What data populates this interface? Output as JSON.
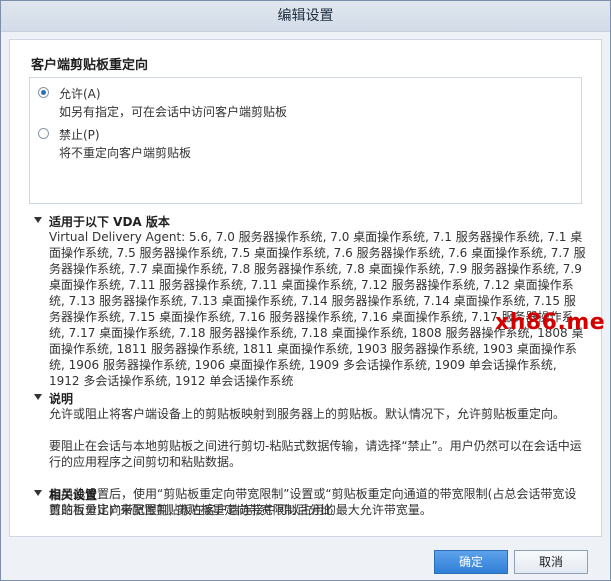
{
  "window": {
    "title": "编辑设置"
  },
  "section": {
    "title": "客户端剪贴板重定向"
  },
  "options": [
    {
      "label": "允许(A)",
      "desc": "如另有指定，可在会话中访问客户端剪贴板",
      "selected": true
    },
    {
      "label": "禁止(P)",
      "desc": "将不重定向客户端剪贴板",
      "selected": false
    }
  ],
  "applies_to": {
    "title": "适用于以下 VDA 版本",
    "text": "Virtual Delivery Agent: 5.6, 7.0 服务器操作系统, 7.0 桌面操作系统, 7.1 服务器操作系统, 7.1 桌面操作系统, 7.5 服务器操作系统, 7.5 桌面操作系统, 7.6 服务器操作系统, 7.6 桌面操作系统, 7.7 服务器操作系统, 7.7 桌面操作系统, 7.8 服务器操作系统, 7.8 桌面操作系统, 7.9 服务器操作系统, 7.9 桌面操作系统, 7.11 服务器操作系统, 7.11 桌面操作系统, 7.12 服务器操作系统, 7.12 桌面操作系统, 7.13 服务器操作系统, 7.13 桌面操作系统, 7.14 服务器操作系统, 7.14 桌面操作系统, 7.15 服务器操作系统, 7.15 桌面操作系统, 7.16 服务器操作系统, 7.16 桌面操作系统, 7.17 服务器操作系统, 7.17 桌面操作系统, 7.18 服务器操作系统, 7.18 桌面操作系统, 1808 服务器操作系统, 1808 桌面操作系统, 1811 服务器操作系统, 1811 桌面操作系统, 1903 服务器操作系统, 1903 桌面操作系统, 1906 服务器操作系统, 1906 桌面操作系统, 1909 多会话操作系统, 1909 单会话操作系统, 1912 多会话操作系统, 1912 单会话操作系统"
  },
  "description": {
    "title": "说明",
    "p1": "允许或阻止将客户端设备上的剪贴板映射到服务器上的剪贴板。默认情况下，允许剪贴板重定向。",
    "p2": "要阻止在会话与本地剪贴板之间进行剪切-粘贴式数据传输，请选择“禁止”。用户仍然可以在会话中运行的应用程序之间剪切和粘贴数据。",
    "p3": "启用此设置后，使用“剪贴板重定向带宽限制”设置或“剪贴板重定向通道的带宽限制(占总会话带宽设置的百分比)”来配置剪贴板在客户端连接中可以占用的最大允许带宽量。"
  },
  "related": {
    "title": "相关设置",
    "text": "剪贴板重定向带宽限制, 剪贴板重定向带宽限制百分比"
  },
  "buttons": {
    "ok": "确定",
    "cancel": "取消"
  },
  "watermark": "xh86.me"
}
